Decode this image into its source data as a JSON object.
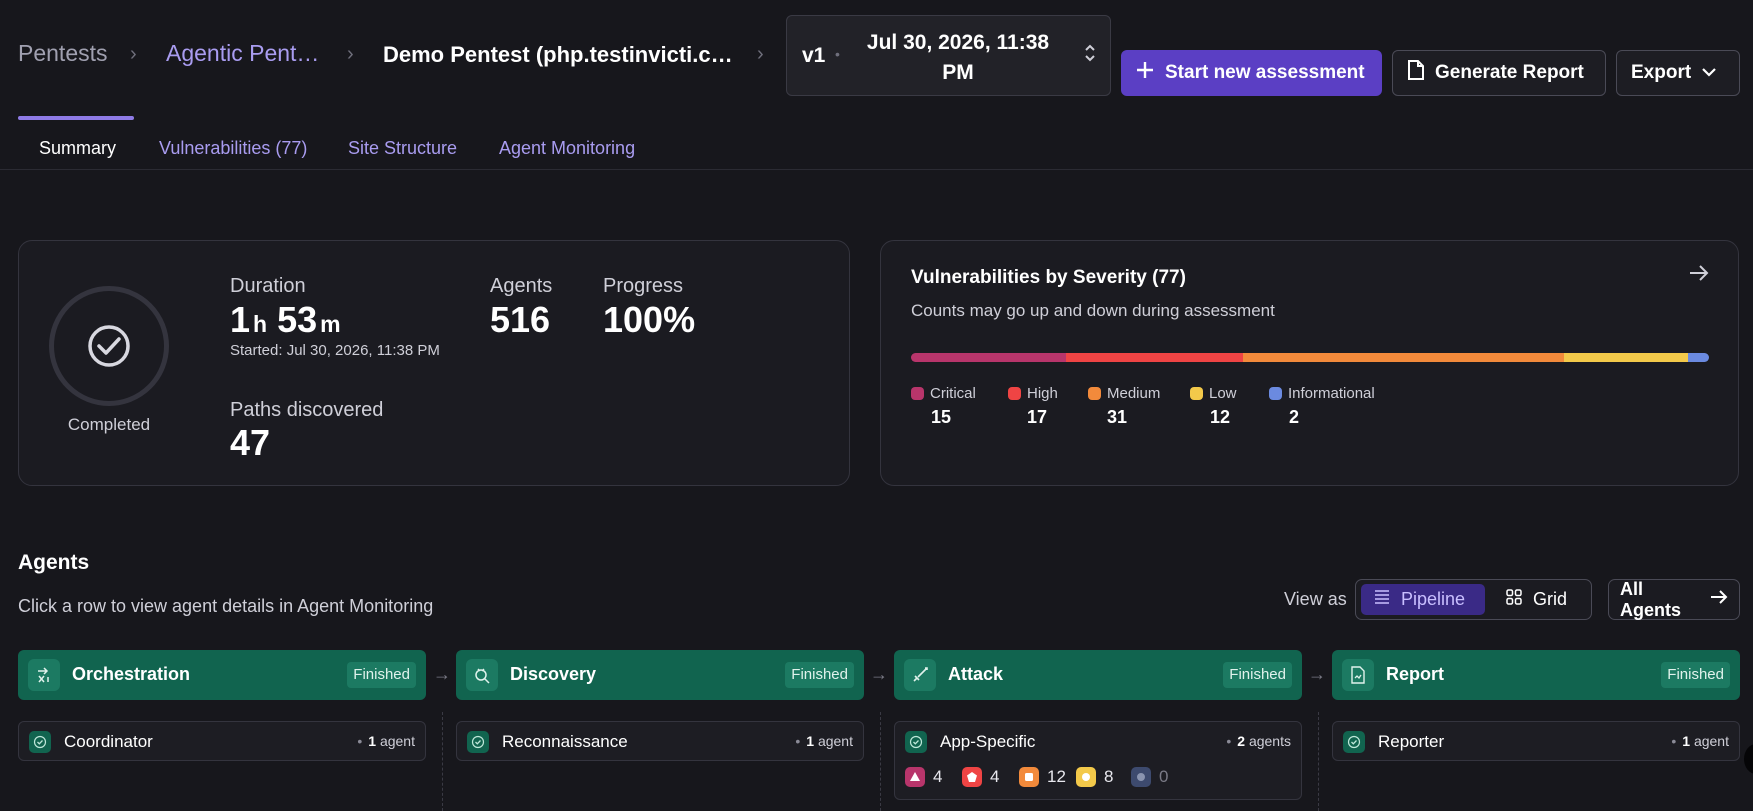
{
  "breadcrumb": {
    "items": [
      "Pentests",
      "Agentic Pent…",
      "Demo Pentest (php.testinvicti.c…"
    ],
    "separator": "›"
  },
  "version": {
    "label": "v1",
    "dot": "•",
    "date_line1": "Jul 30, 2026, 11:38",
    "date_line2": "PM"
  },
  "actions": {
    "start_label": "Start new assessment",
    "report_label": "Generate Report",
    "export_label": "Export"
  },
  "tabs": [
    {
      "label": "Summary",
      "active": true
    },
    {
      "label": "Vulnerabilities (77)",
      "active": false
    },
    {
      "label": "Site Structure",
      "active": false
    },
    {
      "label": "Agent Monitoring",
      "active": false
    }
  ],
  "summary": {
    "status": "Completed",
    "duration_label": "Duration",
    "duration_hours": "1",
    "duration_h_unit": "h",
    "duration_minutes": "53",
    "duration_m_unit": "m",
    "started": "Started: Jul 30, 2026, 11:38 PM",
    "agents_label": "Agents",
    "agents_value": "516",
    "progress_label": "Progress",
    "progress_value": "100%",
    "progress_fraction": 1.0,
    "paths_label": "Paths discovered",
    "paths_value": "47"
  },
  "severity": {
    "title": "Vulnerabilities by Severity (77)",
    "subtitle": "Counts may go up and down during assessment",
    "total": 77,
    "items": [
      {
        "label": "Critical",
        "count": 15,
        "color": "#b8356b"
      },
      {
        "label": "High",
        "count": 17,
        "color": "#ef4444"
      },
      {
        "label": "Medium",
        "count": 31,
        "color": "#f28a3b"
      },
      {
        "label": "Low",
        "count": 12,
        "color": "#f3c94a"
      },
      {
        "label": "Informational",
        "count": 2,
        "color": "#6b8ae0"
      }
    ]
  },
  "agents": {
    "title": "Agents",
    "subtitle": "Click a row to view agent details in Agent Monitoring",
    "view_as_label": "View as",
    "view_pipeline": "Pipeline",
    "view_grid": "Grid",
    "all_agents_label": "All Agents",
    "stages": [
      {
        "name": "Orchestration",
        "status": "Finished",
        "icon": "orchestration-icon",
        "agent": {
          "name": "Coordinator",
          "count": "1",
          "unit": "agent"
        }
      },
      {
        "name": "Discovery",
        "status": "Finished",
        "icon": "discovery-icon",
        "agent": {
          "name": "Reconnaissance",
          "count": "1",
          "unit": "agent"
        }
      },
      {
        "name": "Attack",
        "status": "Finished",
        "icon": "attack-icon",
        "agent": {
          "name": "App-Specific",
          "count": "2",
          "unit": "agents",
          "findings": [
            "4",
            "4",
            "12",
            "8",
            "0"
          ]
        }
      },
      {
        "name": "Report",
        "status": "Finished",
        "icon": "report-icon",
        "agent": {
          "name": "Reporter",
          "count": "1",
          "unit": "agent"
        }
      }
    ]
  },
  "colors": {
    "accent": "#5b3fc4",
    "stage_green": "#11644f",
    "background": "#17171c"
  }
}
